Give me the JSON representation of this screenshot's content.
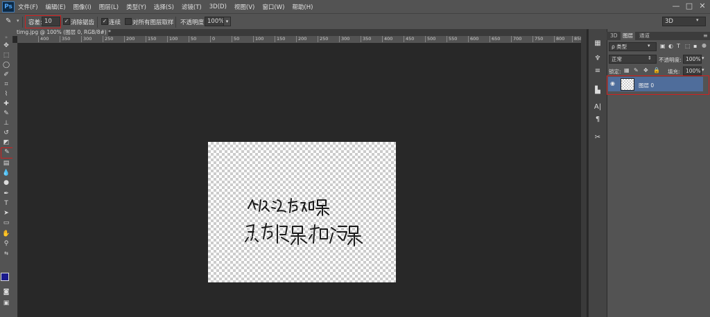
{
  "app": {
    "logo": "Ps"
  },
  "menu": [
    "文件(F)",
    "编辑(E)",
    "图像(I)",
    "图层(L)",
    "类型(Y)",
    "选择(S)",
    "滤镜(T)",
    "3D(D)",
    "视图(V)",
    "窗口(W)",
    "帮助(H)"
  ],
  "window_controls": [
    "—",
    "□",
    "✕"
  ],
  "options": {
    "tolerance_label": "容差:",
    "tolerance_value": "10",
    "antialias_label": "消除锯齿",
    "contiguous_label": "连续",
    "sample_all_label": "对所有图层取样",
    "opacity_label": "不透明度:",
    "opacity_value": "100%",
    "workspace_value": "3D"
  },
  "document": {
    "tab_title": "timg.jpg @ 100% (图层 0, RGB/8#) *",
    "ruler_labels": [
      "400",
      "350",
      "300",
      "250",
      "200",
      "150",
      "100",
      "50",
      "0",
      "50",
      "100",
      "150",
      "200",
      "250",
      "300",
      "350",
      "400",
      "450",
      "500",
      "550",
      "600",
      "650",
      "700",
      "750",
      "800",
      "850"
    ]
  },
  "panel": {
    "tabs": [
      "3D",
      "图层",
      "通道"
    ],
    "filter_kind": "ρ 类型",
    "blend_mode": "正常",
    "opacity_label": "不透明度:",
    "opacity_value": "100%",
    "lock_label": "锁定:",
    "fill_label": "填充:",
    "fill_value": "100%",
    "layers": [
      {
        "name": "图层 0",
        "visible": true,
        "selected": true
      }
    ]
  },
  "colors": {
    "foreground": "#1a1a8c",
    "background": "#ffffff",
    "selection": "#4f6d9b",
    "highlight": "#d02020"
  }
}
